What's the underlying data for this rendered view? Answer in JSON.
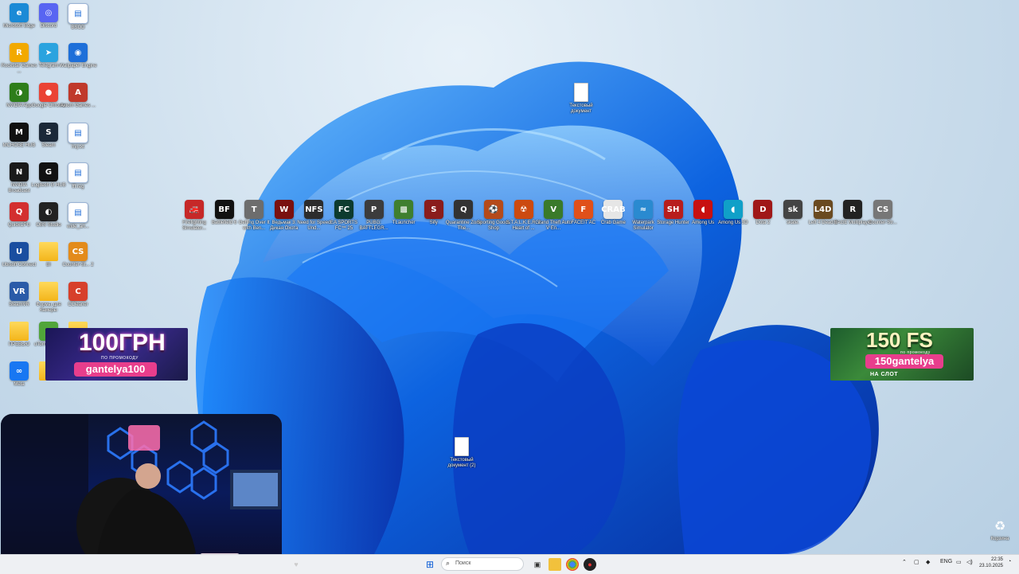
{
  "desktop_icons_left": [
    {
      "label": "Microsoft Edge",
      "color": "#1b8ad6",
      "glyph": "e",
      "icon": "edge-icon"
    },
    {
      "label": "Discord",
      "color": "#5865f2",
      "glyph": "◎",
      "icon": "discord-icon"
    },
    {
      "label": "BSOD",
      "color": "#ffffff",
      "glyph": "",
      "icon": "shortcut-file-icon"
    },
    {
      "label": "Rockstar Games ...",
      "color": "#f2a900",
      "glyph": "R",
      "icon": "rockstar-icon"
    },
    {
      "label": "Telegram",
      "color": "#2aa3df",
      "glyph": "➤",
      "icon": "telegram-icon"
    },
    {
      "label": "Wallpaper Engine",
      "color": "#1e6fd9",
      "glyph": "◉",
      "icon": "wallpaper-engine-icon"
    },
    {
      "label": "NVIDIA App",
      "color": "#2e7d1a",
      "glyph": "◑",
      "icon": "nvidia-icon"
    },
    {
      "label": "Google Chrome",
      "color": "#ea4335",
      "glyph": "●",
      "icon": "chrome-icon"
    },
    {
      "label": "Axiom Games ...",
      "color": "#c0392b",
      "glyph": "A",
      "icon": "axiom-icon"
    },
    {
      "label": "MCHOSE HUB",
      "color": "#111111",
      "glyph": "M",
      "icon": "mchose-icon"
    },
    {
      "label": "Steam",
      "color": "#1b2838",
      "glyph": "S",
      "icon": "steam-icon"
    },
    {
      "label": "hvj.txt",
      "color": "#ffffff",
      "glyph": "",
      "icon": "shortcut-file-icon"
    },
    {
      "label": "NVIDIA Broadcast",
      "color": "#1a1a1a",
      "glyph": "N",
      "icon": "nvidia-broadcast-icon"
    },
    {
      "label": "Logitech G HUB",
      "color": "#111111",
      "glyph": "G",
      "icon": "logitech-icon"
    },
    {
      "label": "fff.reg",
      "color": "#ffffff",
      "glyph": "",
      "icon": "shortcut-file-icon"
    },
    {
      "label": "QuickCPU",
      "color": "#d32f2f",
      "glyph": "Q",
      "icon": "quickcpu-icon"
    },
    {
      "label": "OBS Studio",
      "color": "#222222",
      "glyph": "◐",
      "icon": "obs-icon"
    },
    {
      "label": "wide_art...",
      "color": "#ffffff",
      "glyph": "",
      "icon": "shortcut-file-icon"
    },
    {
      "label": "Ubisoft Connect",
      "color": "#1a4ea0",
      "glyph": "U",
      "icon": "ubisoft-icon"
    },
    {
      "label": "ВI",
      "color": "folder",
      "glyph": "",
      "icon": "folder-icon"
    },
    {
      "label": "Counter-St... 2",
      "color": "#e38b1b",
      "glyph": "CS",
      "icon": "cs2-icon"
    },
    {
      "label": "SteamVR",
      "color": "#2a5ba8",
      "glyph": "VR",
      "icon": "steamvr-icon"
    },
    {
      "label": "Формы для Камеры",
      "color": "folder",
      "glyph": "",
      "icon": "folder-icon"
    },
    {
      "label": "CCleaner",
      "color": "#d7402b",
      "glyph": "C",
      "icon": "ccleaner-icon"
    },
    {
      "label": "ПРЕВЬЮ",
      "color": "folder",
      "glyph": "",
      "icon": "folder-icon"
    },
    {
      "label": "uTorrent Web",
      "color": "#51a53a",
      "glyph": "μ",
      "icon": "utorrent-icon"
    },
    {
      "label": "Скриншоты",
      "color": "folder",
      "glyph": "",
      "icon": "folder-icon"
    },
    {
      "label": "Meta",
      "color": "#1877f2",
      "glyph": "∞",
      "icon": "meta-icon"
    },
    {
      "label": "",
      "color": "folder",
      "glyph": "",
      "icon": "folder-icon"
    }
  ],
  "desktop_icons_row": [
    {
      "label": "Firefighting Simulator...",
      "color": "#c62828",
      "glyph": "🚒"
    },
    {
      "label": "Battlefield 6",
      "color": "#111111",
      "glyph": "BF"
    },
    {
      "label": "Getting Over It with Ben...",
      "color": "#6d6d6d",
      "glyph": "T"
    },
    {
      "label": "Ведьмак 3: Дикая Охота",
      "color": "#7a1010",
      "glyph": "W"
    },
    {
      "label": "Need for Speed Und...",
      "color": "#2c2c2c",
      "glyph": "NFS"
    },
    {
      "label": "EA SPORTS FC™ 25",
      "color": "#0d3b2e",
      "glyph": "FC"
    },
    {
      "label": "PUBG: BATTLEGR...",
      "color": "#3c3c3c",
      "glyph": "P"
    },
    {
      "label": "TLauncher",
      "color": "#3f7f2f",
      "glyph": "▩"
    },
    {
      "label": "Sify",
      "color": "#8a1c1c",
      "glyph": "S"
    },
    {
      "label": "Quarantine Zone The...",
      "color": "#333333",
      "glyph": "Q"
    },
    {
      "label": "Sporting Goods Shop",
      "color": "#b54a1a",
      "glyph": "⚽"
    },
    {
      "label": "S.T.A.L.K.E.R. 2 Heart of ...",
      "color": "#cc4a10",
      "glyph": "☢"
    },
    {
      "label": "Grand Theft Auto V En...",
      "color": "#3a7a2a",
      "glyph": "V"
    },
    {
      "label": "FACEIT AC",
      "color": "#e0501a",
      "glyph": "F"
    },
    {
      "label": "Crab Game",
      "color": "#e6e6e6",
      "glyph": "CRAB"
    },
    {
      "label": "Waterpark Simulator",
      "color": "#2a8ad0",
      "glyph": "≈"
    },
    {
      "label": "Storage Hunter",
      "color": "#b81d1d",
      "glyph": "SH"
    },
    {
      "label": "Among Us",
      "color": "#c81010",
      "glyph": "◖"
    },
    {
      "label": "Among Us 3D",
      "color": "#10a0c8",
      "glyph": "◖"
    },
    {
      "label": "Dota 2",
      "color": "#a01818",
      "glyph": "D"
    },
    {
      "label": "skate.",
      "color": "#444444",
      "glyph": "sk"
    },
    {
      "label": "Left 4 Dead 2",
      "color": "#6a4a20",
      "glyph": "L4D"
    },
    {
      "label": "RAGE Multiplayer",
      "color": "#222222",
      "glyph": "R"
    },
    {
      "label": "Counter-Str...",
      "color": "#777777",
      "glyph": "CS"
    }
  ],
  "desktop_docs": [
    {
      "label": "Текстовый документ"
    },
    {
      "label": "Текстовый документ (2)"
    }
  ],
  "recycle_bin": {
    "label": "Корзина"
  },
  "promo_left": {
    "big": "100ГРН",
    "sub": "ПО ПРОМОКОДУ",
    "code": "gantelya100"
  },
  "promo_right": {
    "big": "150 FS",
    "sub": "по промокоду",
    "code": "150gantelya",
    "extra": "НА СЛОТ"
  },
  "taskbar": {
    "search_placeholder": "Поиск",
    "language": "ENG",
    "time": "22:35",
    "date": "23.10.2025"
  }
}
